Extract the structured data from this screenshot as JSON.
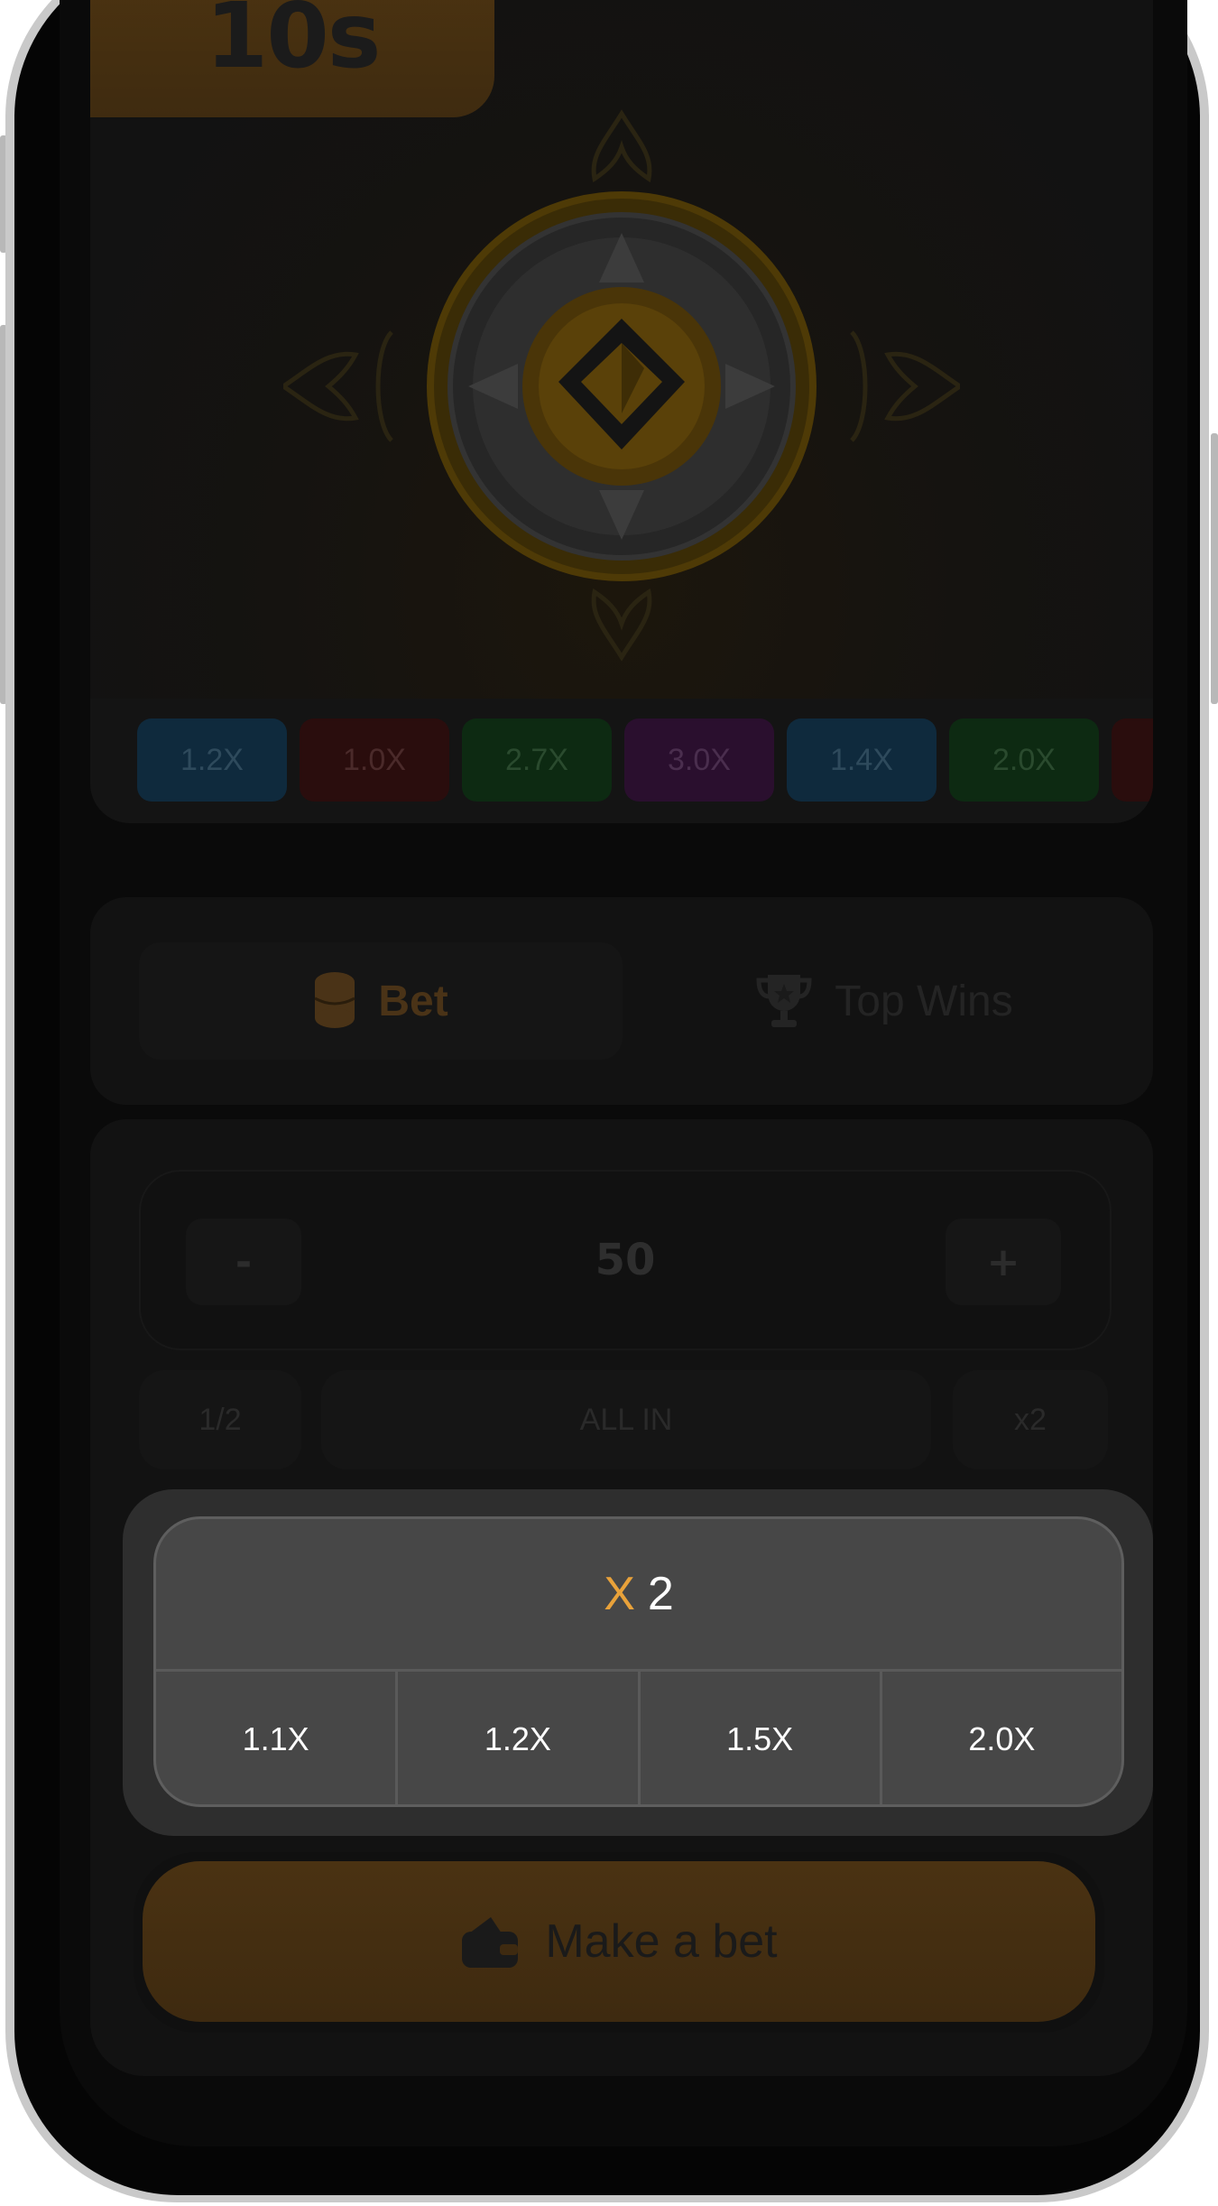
{
  "game": {
    "timer": "10s",
    "multiplier_history": [
      {
        "label": "1.2X",
        "color": "#0f2a3d",
        "text_color": "#2e4a5c"
      },
      {
        "label": "1.0X",
        "color": "#2a0d0d",
        "text_color": "#4a2a2a"
      },
      {
        "label": "2.7X",
        "color": "#0d2a12",
        "text_color": "#2a4a2e"
      },
      {
        "label": "3.0X",
        "color": "#2a0f2e",
        "text_color": "#4a2e4e"
      },
      {
        "label": "1.4X",
        "color": "#0f2a3d",
        "text_color": "#2e4a5c"
      },
      {
        "label": "2.0X",
        "color": "#0d2a12",
        "text_color": "#2a4a2e"
      },
      {
        "label": "",
        "color": "#2a0d0d",
        "text_color": "#4a2a2a"
      }
    ]
  },
  "tabs": {
    "bet": "Bet",
    "top_wins": "Top Wins"
  },
  "bet_panel": {
    "minus": "-",
    "amount": "50",
    "plus": "+",
    "half": "1/2",
    "all_in": "ALL IN",
    "double": "x2"
  },
  "multiplier_popup": {
    "prefix": "X",
    "value": "2",
    "options": [
      "1.1X",
      "1.2X",
      "1.5X",
      "2.0X"
    ]
  },
  "make_bet": {
    "label": "Make a bet"
  },
  "colors": {
    "accent": "#e9a23a",
    "popup_bg": "#474747"
  }
}
